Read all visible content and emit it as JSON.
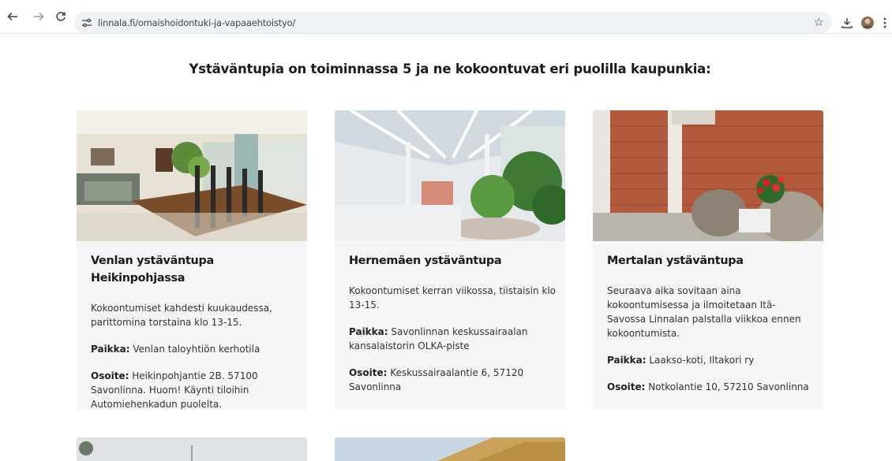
{
  "browser": {
    "url": "linnala.fi/omaishoidontuki-ja-vapaaehtoistyo/"
  },
  "page": {
    "heading": "Ystäväntupia on toiminnassa 5 ja ne kokoontuvat eri puolilla kaupunkia:"
  },
  "cards": [
    {
      "title": "Venlan ystäväntupa Heikinpohjassa",
      "desc": "Kokoontumiset kahdesti kuukaudessa, parittomina torstaina klo 13-15.",
      "place_label": "Paikka:",
      "place": "Venlan taloyhtiön kerhotila",
      "addr_label": "Osoite:",
      "addr": "Heikinpohjantie 2B. 57100 Savonlinna. Huom! Käynti tiloihin Automiehenkadun puolelta."
    },
    {
      "title": "Hernemäen ystäväntupa",
      "desc": "Kokoontumiset kerran viikossa, tiistaisin klo 13-15.",
      "place_label": "Paikka:",
      "place": "Savonlinnan keskussairaalan kansalaistorin OLKA-piste",
      "addr_label": "Osoite:",
      "addr": "Keskussairaalantie 6, 57120 Savonlinna"
    },
    {
      "title": "Mertalan ystäväntupa",
      "desc": "Seuraava aika sovitaan aina kokoontumisessa ja ilmoitetaan Itä-Savossa Linnalan palstalla viikkoa ennen kokoontumista.",
      "place_label": "Paikka:",
      "place": "Laakso-koti, Iltakori ry",
      "addr_label": "Osoite:",
      "addr": "Notkolantie 10, 57210 Savonlinna"
    }
  ]
}
